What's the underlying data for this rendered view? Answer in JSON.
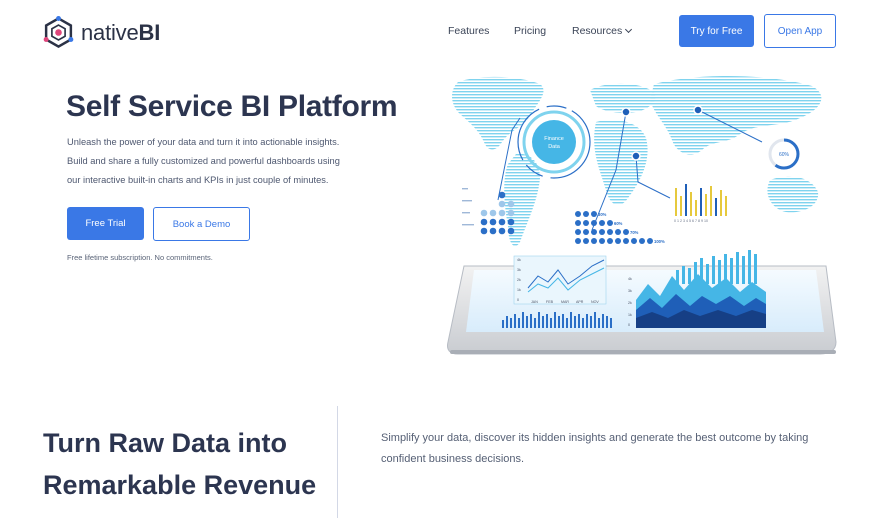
{
  "brand": {
    "name_light": "native",
    "name_bold": "BI",
    "logo_icon": "hexagon-network-logo"
  },
  "nav": {
    "features": "Features",
    "pricing": "Pricing",
    "resources": "Resources",
    "try_free": "Try for Free",
    "open_app": "Open App"
  },
  "hero": {
    "title": "Self Service BI Platform",
    "desc_line1": "Unleash the power of your data and turn it into actionable insights.",
    "desc_line2": "Build and share a fully customized and powerful dashboards using",
    "desc_line3": "our interactive built-in charts and KPIs in just couple of minutes.",
    "free_trial": "Free Trial",
    "book_demo": "Book a Demo",
    "note": "Free lifetime subscription. No commitments."
  },
  "illustration": {
    "finance_label_1": "Finance",
    "finance_label_2": "Data",
    "gauge_label": "60%",
    "pct_labels": [
      "30%",
      "60%",
      "70%",
      "100%"
    ],
    "line_months": [
      "JAN",
      "FEB",
      "MAR",
      "APR",
      "NOV"
    ],
    "line_yticks": [
      "4k",
      "3k",
      "2k",
      "1k",
      "0"
    ],
    "area_yticks": [
      "4k",
      "3k",
      "2k",
      "1k",
      "0"
    ],
    "bar_xticks": "0 1 2 3 4 5 6 7 8 9 10"
  },
  "section2": {
    "title_line1": "Turn Raw Data into",
    "title_line2": "Remarkable Revenue",
    "desc_line1": "Simplify your data, discover its hidden insights and generate the best outcome by taking",
    "desc_line2": "confident business decisions."
  },
  "colors": {
    "accent": "#3a78e6",
    "heading": "#2c3550",
    "map": "#7fd3ee"
  }
}
